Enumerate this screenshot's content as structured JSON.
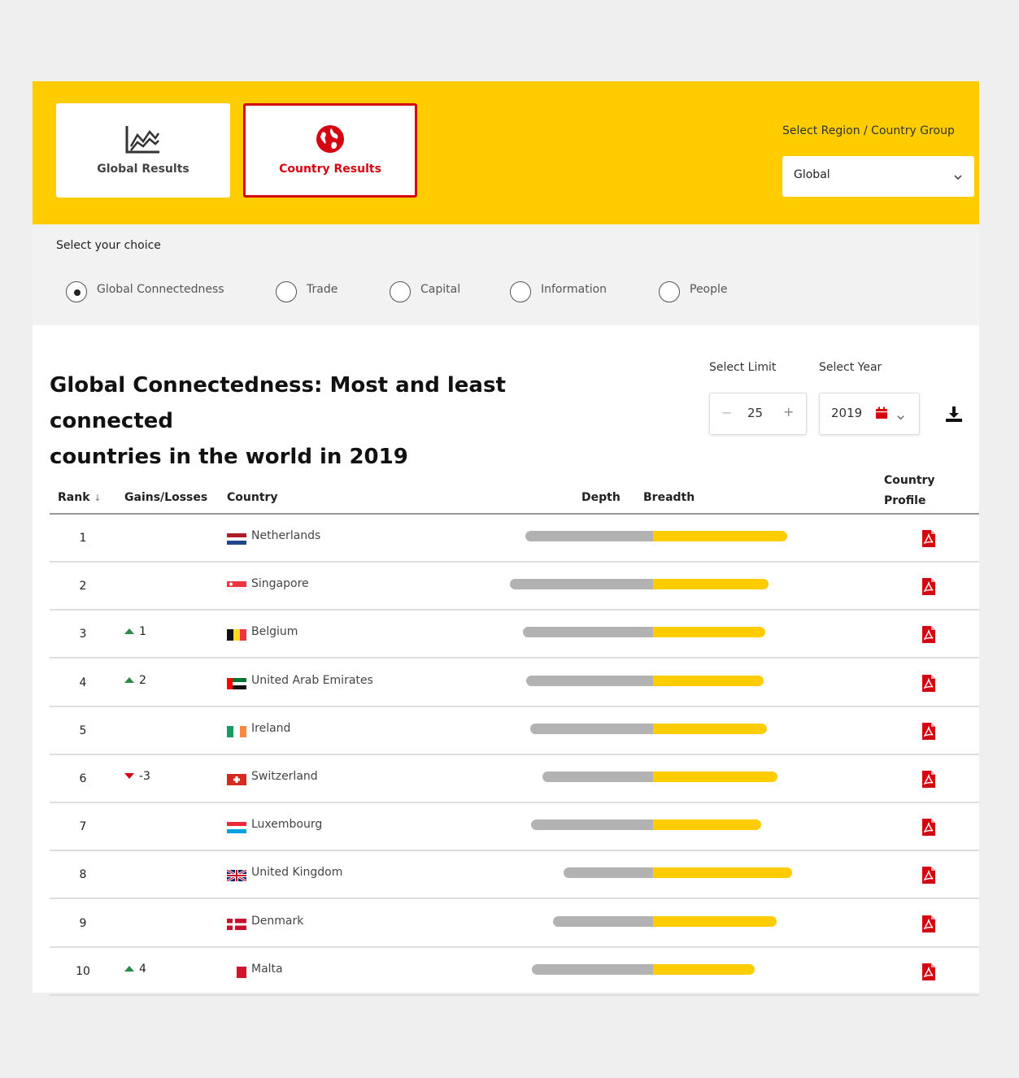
{
  "tabs": [
    {
      "label": "Global Results",
      "icon": "line-chart-icon"
    },
    {
      "label": "Country Results",
      "icon": "globe-icon"
    }
  ],
  "region": {
    "label": "Select Region / Country Group",
    "value": "Global"
  },
  "choice": {
    "title": "Select your choice",
    "options": [
      "Global Connectedness",
      "Trade",
      "Capital",
      "Information",
      "People"
    ],
    "selected": "Global Connectedness"
  },
  "heading": {
    "line1": "Global Connectedness: Most and least connected",
    "line2": "countries in the world in 2019"
  },
  "controls": {
    "limit_label": "Select Limit",
    "limit_value": "25",
    "minus": "−",
    "plus": "+",
    "year_label": "Select Year",
    "year_value": "2019"
  },
  "table": {
    "headers": {
      "rank": "Rank",
      "gains": "Gains/Losses",
      "country": "Country",
      "depth": "Depth",
      "breadth": "Breadth",
      "profile_line1": "Country",
      "profile_line2": "Profile"
    },
    "rows": [
      {
        "rank": "1",
        "gain": "",
        "dir": "",
        "country": "Netherlands",
        "flag": "netherlands-flag-icon",
        "depth": 157,
        "breadth": 165
      },
      {
        "rank": "2",
        "gain": "",
        "dir": "",
        "country": "Singapore",
        "flag": "singapore-flag-icon",
        "depth": 176,
        "breadth": 142
      },
      {
        "rank": "3",
        "gain": "1",
        "dir": "up",
        "country": "Belgium",
        "flag": "belgium-flag-icon",
        "depth": 160,
        "breadth": 138
      },
      {
        "rank": "4",
        "gain": "2",
        "dir": "up",
        "country": "United Arab Emirates",
        "flag": "uae-flag-icon",
        "depth": 156,
        "breadth": 136
      },
      {
        "rank": "5",
        "gain": "",
        "dir": "",
        "country": "Ireland",
        "flag": "ireland-flag-icon",
        "depth": 151,
        "breadth": 140
      },
      {
        "rank": "6",
        "gain": "-3",
        "dir": "down",
        "country": "Switzerland",
        "flag": "switzerland-flag-icon",
        "depth": 136,
        "breadth": 153
      },
      {
        "rank": "7",
        "gain": "",
        "dir": "",
        "country": "Luxembourg",
        "flag": "luxembourg-flag-icon",
        "depth": 150,
        "breadth": 133
      },
      {
        "rank": "8",
        "gain": "",
        "dir": "",
        "country": "United Kingdom",
        "flag": "uk-flag-icon",
        "depth": 110,
        "breadth": 171
      },
      {
        "rank": "9",
        "gain": "",
        "dir": "",
        "country": "Denmark",
        "flag": "denmark-flag-icon",
        "depth": 123,
        "breadth": 152
      },
      {
        "rank": "10",
        "gain": "4",
        "dir": "up",
        "country": "Malta",
        "flag": "malta-flag-icon",
        "depth": 149,
        "breadth": 125
      }
    ]
  },
  "colors": {
    "brand_yellow": "#ffcc00",
    "brand_red": "#d40511",
    "depth_gray": "#b2b2b2",
    "gain_green": "#2a8a4a"
  }
}
